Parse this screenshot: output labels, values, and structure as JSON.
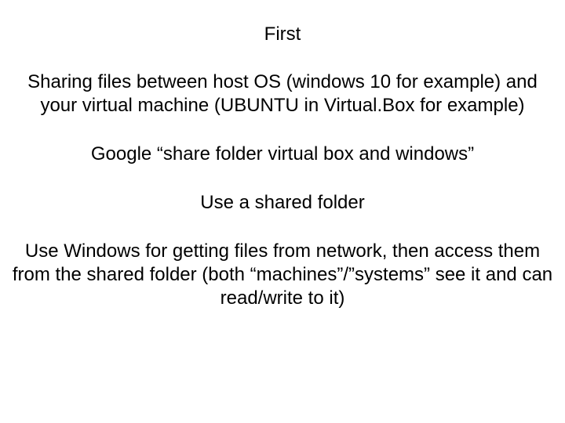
{
  "slide": {
    "title": "First",
    "paragraphs": [
      "Sharing files between host OS (windows 10 for example) and your virtual machine (UBUNTU in Virtual.Box for example)",
      "Google “share folder virtual box and windows”",
      "Use a shared folder",
      "Use Windows for getting files from network, then access them from the shared folder (both “machines”/”systems” see it and can read/write to it)"
    ]
  }
}
